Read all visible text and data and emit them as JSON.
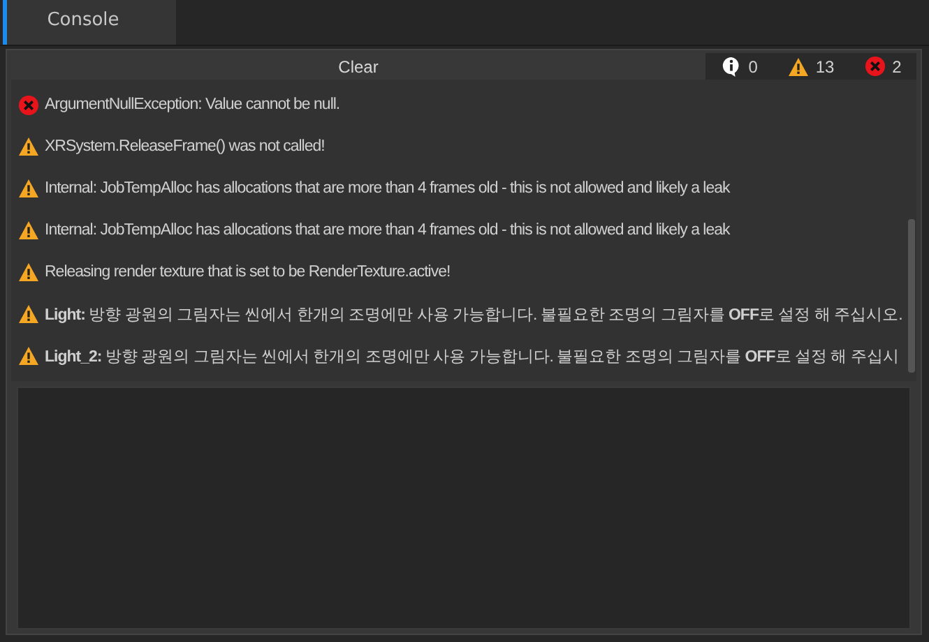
{
  "tabs": [
    {
      "label": "Console",
      "selected": true
    }
  ],
  "toolbar": {
    "clear_button": "Clear",
    "counters": [
      {
        "kind": "info",
        "count": "0"
      },
      {
        "kind": "warning",
        "count": "13"
      },
      {
        "kind": "error",
        "count": "2"
      }
    ]
  },
  "messages": [
    {
      "kind": "error",
      "text": "ArgumentNullException: Value cannot be null."
    },
    {
      "kind": "warning",
      "text": "XRSystem.ReleaseFrame() was not called!"
    },
    {
      "kind": "warning",
      "text": "Internal: JobTempAlloc has allocations that are more than 4 frames old - this is not allowed and likely a leak"
    },
    {
      "kind": "warning",
      "text": "Internal: JobTempAlloc has allocations that are more than 4 frames old - this is not allowed and likely a leak"
    },
    {
      "kind": "warning",
      "text": "Releasing render texture that is set to be RenderTexture.active!"
    },
    {
      "kind": "warning",
      "text": "**Light:** 방향 광원의 그림자는 씬에서 한개의 조명에만 사용 가능합니다. 불필요한 조명의 그림자를 **OFF**로 설정 해 주십시오."
    },
    {
      "kind": "warning",
      "text": "**Light_2:** 방향 광원의 그림자는 씬에서 한개의 조명에만 사용 가능합니다. 불필요한 조명의 그림자를 **OFF**로 설정 해 주십시"
    }
  ]
}
